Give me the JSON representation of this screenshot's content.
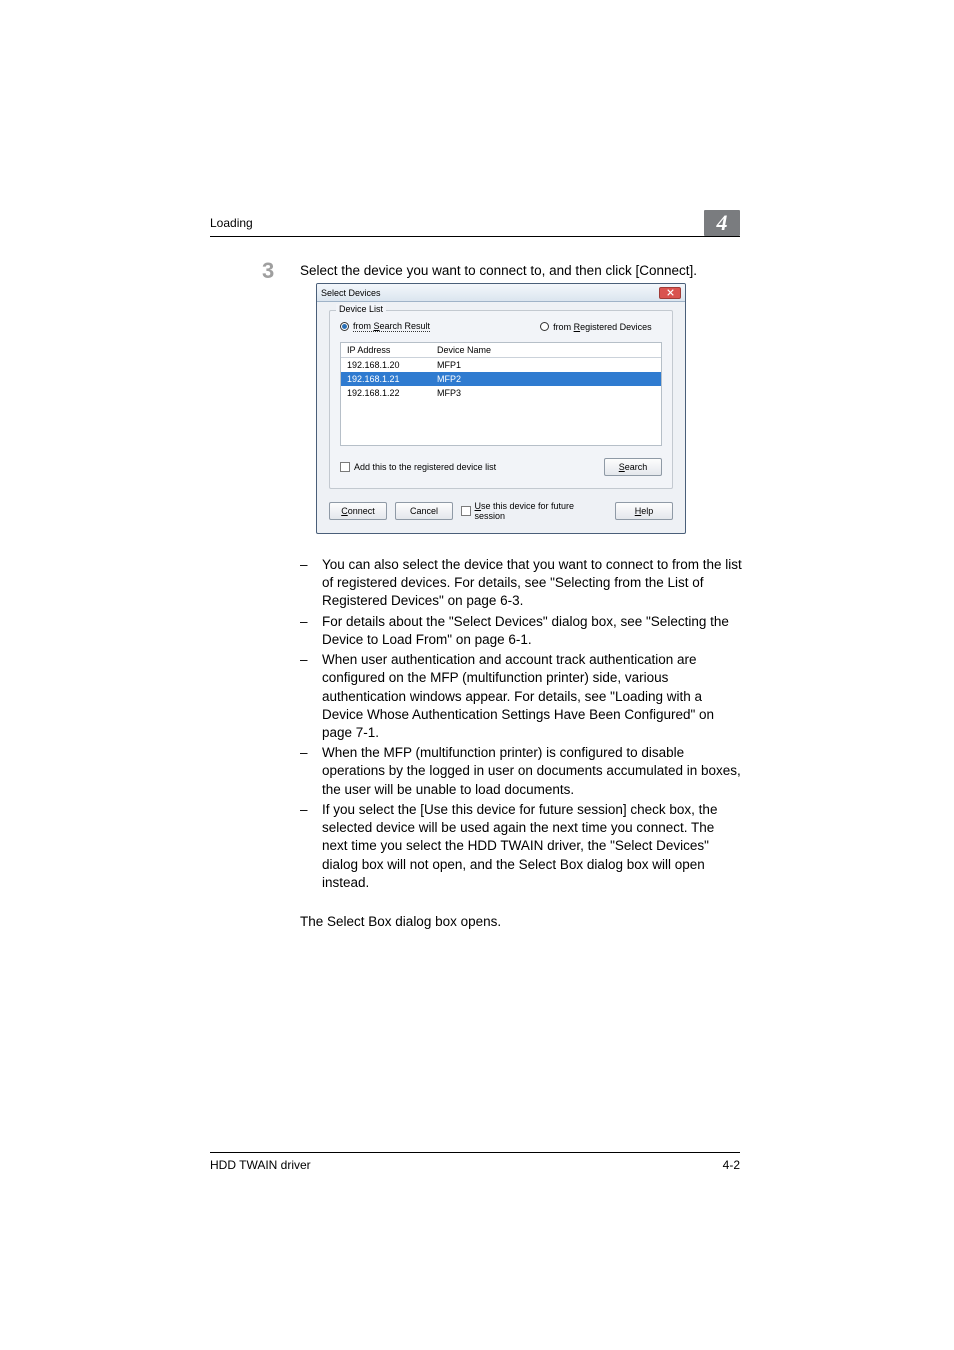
{
  "header": {
    "running_title": "Loading",
    "chapter_num": "4"
  },
  "step": {
    "number": "3",
    "text": "Select the device you want to connect to, and then click [Connect]."
  },
  "dialog": {
    "title": "Select Devices",
    "group_legend": "Device List",
    "radio_search": {
      "prefix": "from ",
      "u": "S",
      "rest": "earch Result"
    },
    "radio_registered": {
      "prefix": "from ",
      "u": "R",
      "rest": "egistered Devices"
    },
    "columns": {
      "ip": "IP Address",
      "name": "Device Name"
    },
    "rows": [
      {
        "ip": "192.168.1.20",
        "name": "MFP1",
        "selected": false
      },
      {
        "ip": "192.168.1.21",
        "name": "MFP2",
        "selected": true
      },
      {
        "ip": "192.168.1.22",
        "name": "MFP3",
        "selected": false
      }
    ],
    "add_registered_label": "Add this to the registered device list",
    "search_btn": {
      "u": "S",
      "rest": "earch"
    },
    "connect_btn": {
      "u": "C",
      "rest": "onnect"
    },
    "cancel_btn": "Cancel",
    "future_label": {
      "u": "U",
      "rest": "se this device for future session"
    },
    "help_btn": {
      "u": "H",
      "rest": "elp"
    }
  },
  "bullets": [
    "You can also select the device that you want to connect to from the list of registered devices. For details, see \"Selecting from the List of Registered Devices\" on page 6-3.",
    "For details about the \"Select Devices\" dialog box, see \"Selecting the Device to Load From\" on page 6-1.",
    "When user authentication and account track authentication are configured on the MFP (multifunction printer) side, various authentication windows appear. For details, see \"Loading with a Device Whose Authentication Settings Have Been Configured\" on page 7-1.",
    "When the MFP (multifunction printer) is configured to disable operations by the logged in user on documents accumulated in boxes, the user will be unable to load documents.",
    "If you select the [Use this device for future session] check box, the selected device will be used again the next time you connect. The next time you select the HDD TWAIN driver, the \"Select Devices\" dialog box will not open, and the Select Box dialog box will open instead."
  ],
  "trailing_text": "The Select Box dialog box opens.",
  "footer": {
    "left": "HDD TWAIN driver",
    "right": "4-2"
  }
}
